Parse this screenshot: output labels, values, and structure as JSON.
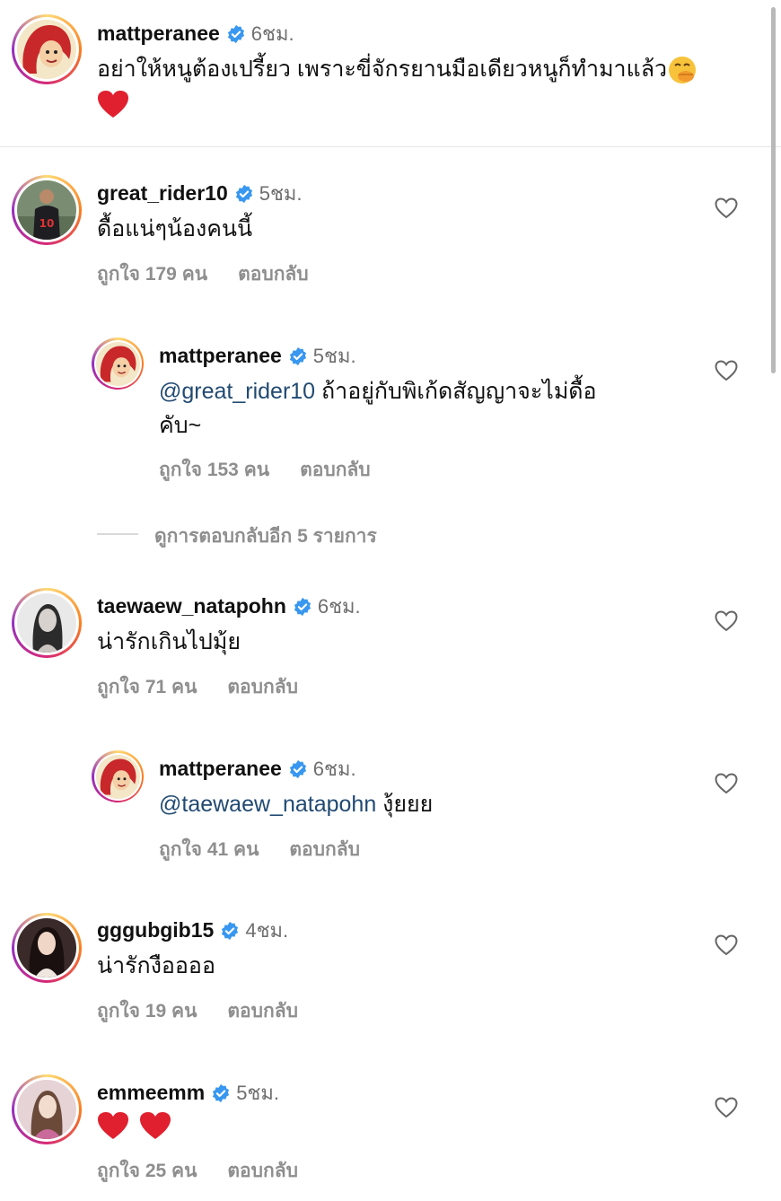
{
  "caption": {
    "username": "mattperanee",
    "time": "6ชม.",
    "text": "อย่าให้หนูต้องเปรี้ยว เพราะขี่จักรยานมือเดียวหนูก็ทำมาแล้ว",
    "emoji_1": "face-with-hand-over-mouth",
    "emoji_2": "red-heart"
  },
  "comments": [
    {
      "username": "great_rider10",
      "time": "5ชม.",
      "text": "ดื้อแน่ๆน้องคนนี้",
      "likes": "ถูกใจ 179 คน",
      "reply": "ตอบกลับ"
    },
    {
      "username": "mattperanee",
      "time": "5ชม.",
      "mention": "@great_rider10",
      "text": " ถ้าอยู่กับพิเก้ดสัญญาจะไม่ดื้อ",
      "text2": "คับ~",
      "likes": "ถูกใจ 153 คน",
      "reply": "ตอบกลับ"
    },
    {
      "username": "taewaew_natapohn",
      "time": "6ชม.",
      "text": "น่ารักเกินไปมุ้ย",
      "likes": "ถูกใจ 71 คน",
      "reply": "ตอบกลับ"
    },
    {
      "username": "mattperanee",
      "time": "6ชม.",
      "mention": "@taewaew_natapohn",
      "text": " งุ้ยยย",
      "likes": "ถูกใจ 41 คน",
      "reply": "ตอบกลับ"
    },
    {
      "username": "gggubgib15",
      "time": "4ชม.",
      "text": "น่ารักงืออออ",
      "likes": "ถูกใจ 19 คน",
      "reply": "ตอบกลับ"
    },
    {
      "username": "emmeemm",
      "time": "5ชม.",
      "text_emoji": "red-heart red-heart",
      "likes": "ถูกใจ 25 คน",
      "reply": "ตอบกลับ"
    }
  ],
  "view_more_replies": "ดูการตอบกลับอีก 5 รายการ",
  "colors": {
    "verified": "#3897f0",
    "meta_gray": "#8e8e8e",
    "mention": "#214a72",
    "heart_red": "#e0202e"
  },
  "icons": {
    "verified": "verified-badge-icon",
    "like": "heart-outline-icon"
  }
}
